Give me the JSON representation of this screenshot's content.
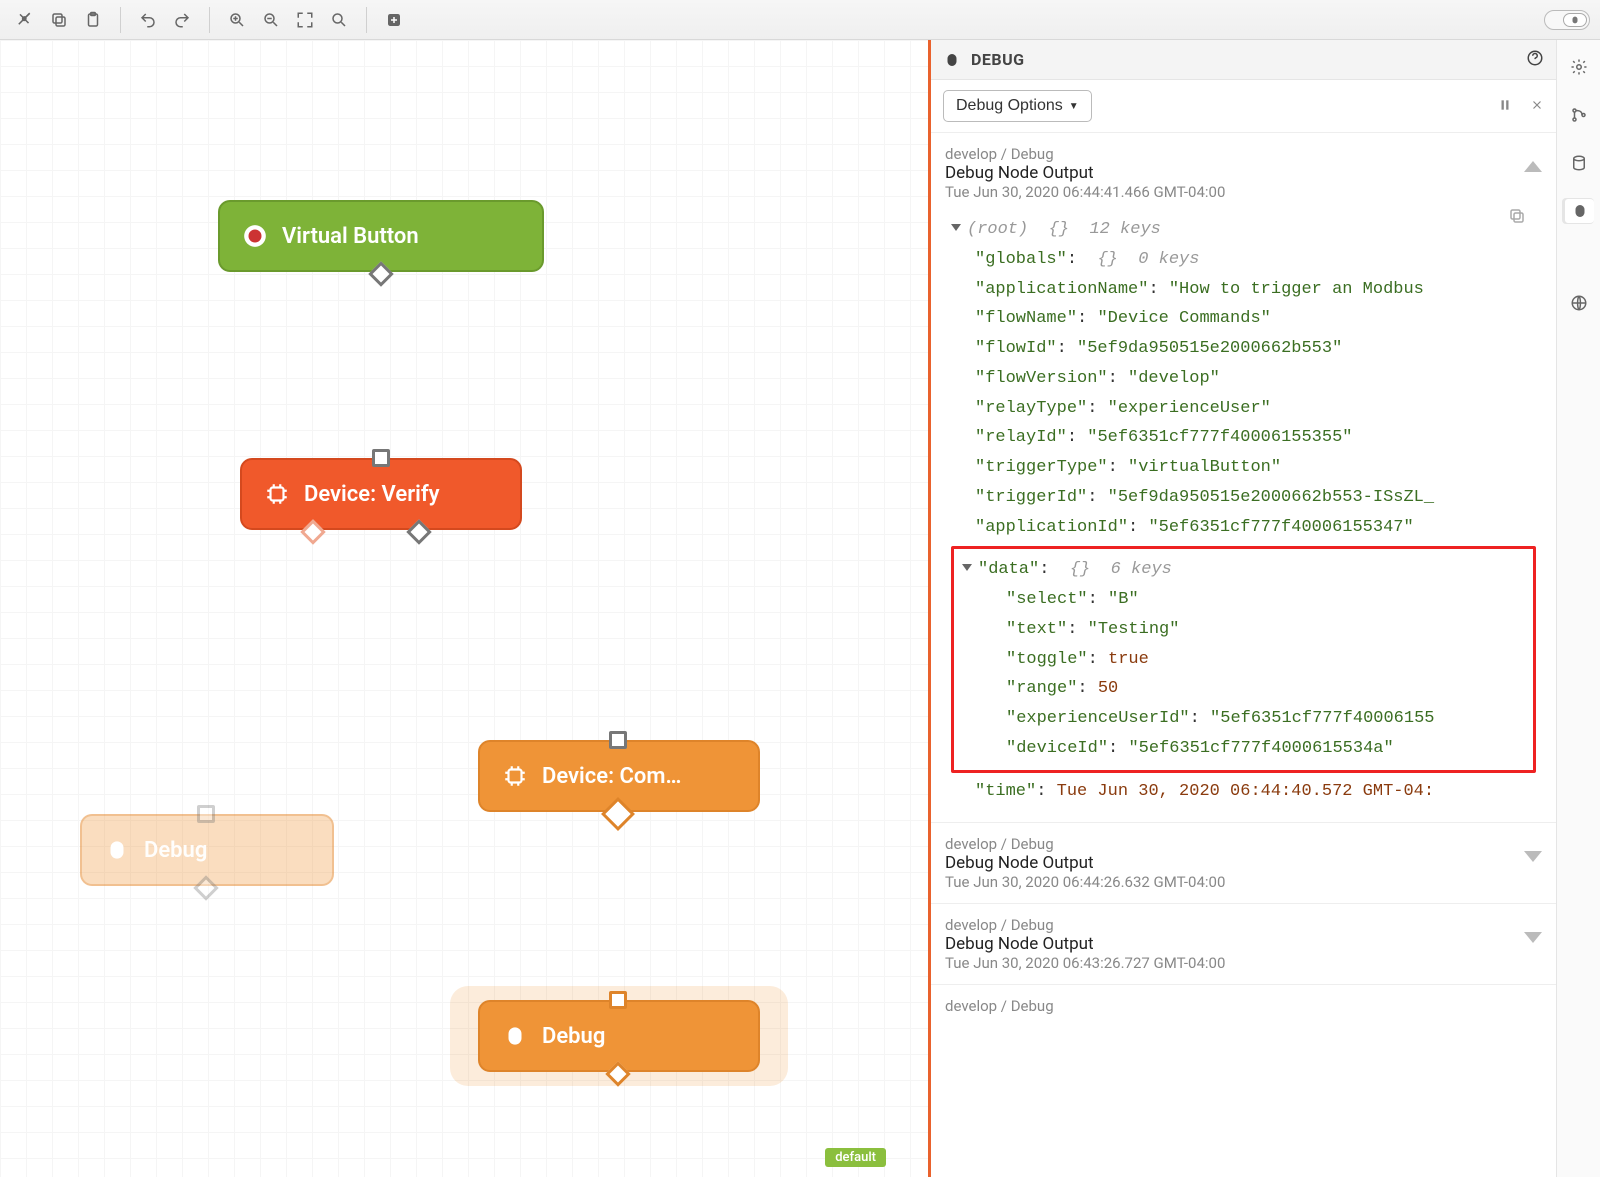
{
  "toolbar": {
    "default_badge": "default"
  },
  "debug": {
    "panel_title": "DEBUG",
    "options_button": "Debug Options",
    "entries": [
      {
        "breadcrumb": "develop / Debug",
        "title": "Debug Node Output",
        "timestamp": "Tue Jun 30, 2020 06:44:41.466 GMT-04:00",
        "expanded": true
      },
      {
        "breadcrumb": "develop / Debug",
        "title": "Debug Node Output",
        "timestamp": "Tue Jun 30, 2020 06:44:26.632 GMT-04:00",
        "expanded": false
      },
      {
        "breadcrumb": "develop / Debug",
        "title": "Debug Node Output",
        "timestamp": "Tue Jun 30, 2020 06:43:26.727 GMT-04:00",
        "expanded": false
      },
      {
        "breadcrumb": "develop / Debug",
        "title": "",
        "timestamp": ""
      }
    ],
    "root_label": "(root)",
    "root_keys_label": "12 keys",
    "payload": {
      "globals_keys_label": "0 keys",
      "applicationName": "How to trigger an Modbus ",
      "flowName": "Device Commands",
      "flowId": "5ef9da950515e2000662b553",
      "flowVersion": "develop",
      "relayType": "experienceUser",
      "relayId": "5ef6351cf777f40006155355",
      "triggerType": "virtualButton",
      "triggerId": "5ef9da950515e2000662b553-ISsZL_",
      "applicationId": "5ef6351cf777f40006155347",
      "data_keys_label": "6 keys",
      "data": {
        "select": "B",
        "text": "Testing",
        "toggle": "true",
        "range": "50",
        "experienceUserId": "5ef6351cf777f40006155",
        "deviceId": "5ef6351cf777f4000615534a"
      },
      "time": "Tue Jun 30, 2020 06:44:40.572 GMT-04:"
    }
  },
  "nodes": {
    "virtual_button": "Virtual Button",
    "device_verify": "Device: Verify",
    "device_command": "Device: Com…",
    "debug": "Debug",
    "debug_faded": "Debug"
  }
}
